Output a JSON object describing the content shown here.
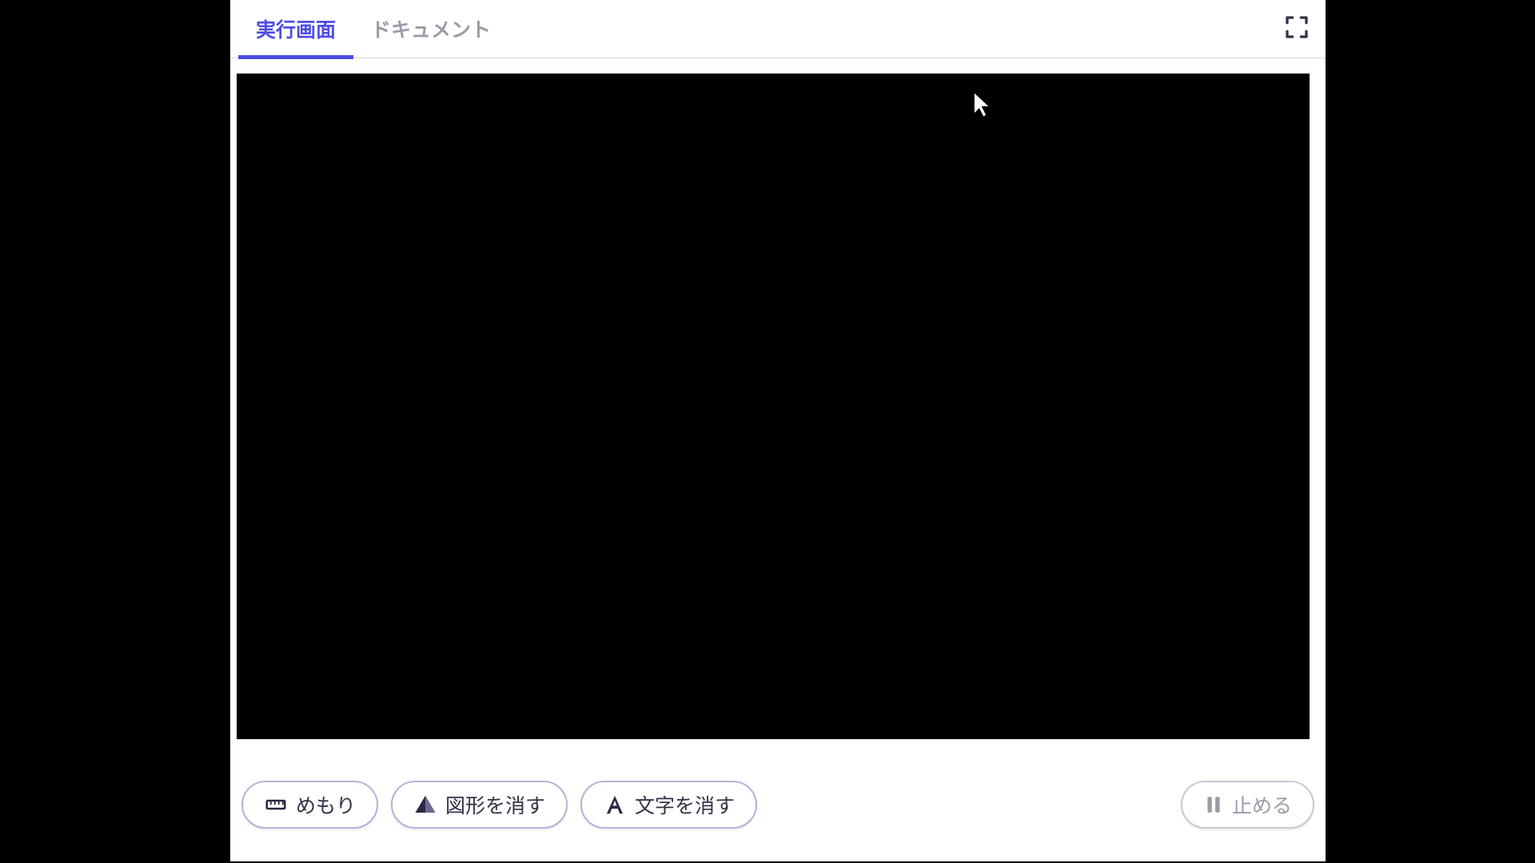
{
  "tabs": {
    "run": "実行画面",
    "document": "ドキュメント"
  },
  "toolbar": {
    "ruler_label": "めもり",
    "clear_shapes_label": "図形を消す",
    "clear_text_label": "文字を消す",
    "stop_label": "止める"
  }
}
